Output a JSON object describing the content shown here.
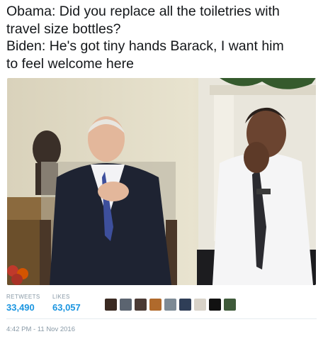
{
  "tweet": {
    "lines": [
      "Obama: Did you replace all the toiletries with",
      "travel size bottles?",
      "Biden: He's got tiny hands Barack, I want him",
      "to feel welcome here"
    ]
  },
  "photo": {
    "description_icon": "photo-image"
  },
  "stats": {
    "retweets_label": "RETWEETS",
    "retweets_value": "33,490",
    "likes_label": "LIKES",
    "likes_value": "63,057"
  },
  "liked_by_avatars": [
    {
      "color": "#3a2a22"
    },
    {
      "color": "#5b6470"
    },
    {
      "color": "#4a3a34"
    },
    {
      "color": "#b06a2c"
    },
    {
      "color": "#7d8a95"
    },
    {
      "color": "#2f3e57"
    },
    {
      "color": "#d8d2c8"
    },
    {
      "color": "#111111"
    },
    {
      "color": "#3f5a3a"
    }
  ],
  "timestamp": "4:42 PM - 11 Nov 2016"
}
